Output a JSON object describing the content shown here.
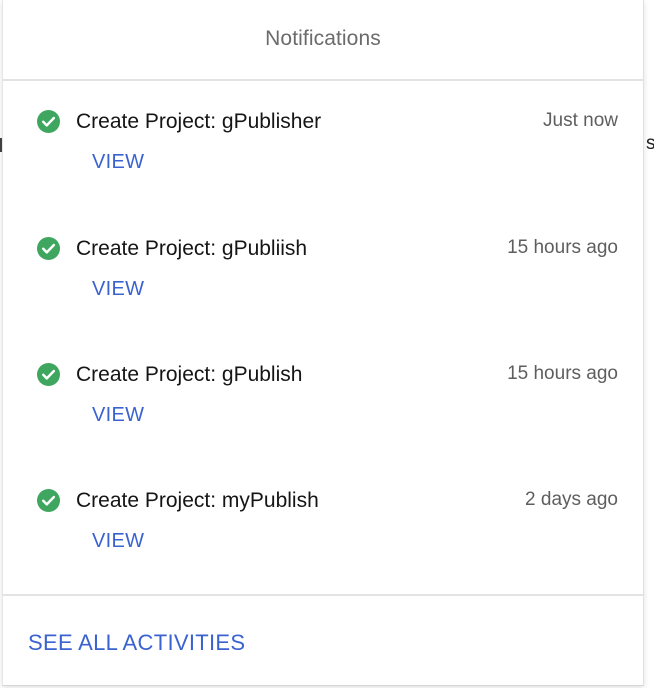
{
  "panel": {
    "title": "Notifications",
    "footer_link": "SEE ALL ACTIVITIES"
  },
  "colors": {
    "accent": "#3b63d0",
    "success": "#3ea65f",
    "title_text": "#151515",
    "muted_text": "#5e5e5e"
  },
  "notifications": [
    {
      "icon": "check-circle-icon",
      "title": "Create Project: gPublisher",
      "time": "Just now",
      "action": "VIEW"
    },
    {
      "icon": "check-circle-icon",
      "title": "Create Project: gPubliish",
      "time": "15 hours ago",
      "action": "VIEW"
    },
    {
      "icon": "check-circle-icon",
      "title": "Create Project: gPublish",
      "time": "15 hours ago",
      "action": "VIEW"
    },
    {
      "icon": "check-circle-icon",
      "title": "Create Project: myPublish",
      "time": "2 days ago",
      "action": "VIEW"
    }
  ]
}
